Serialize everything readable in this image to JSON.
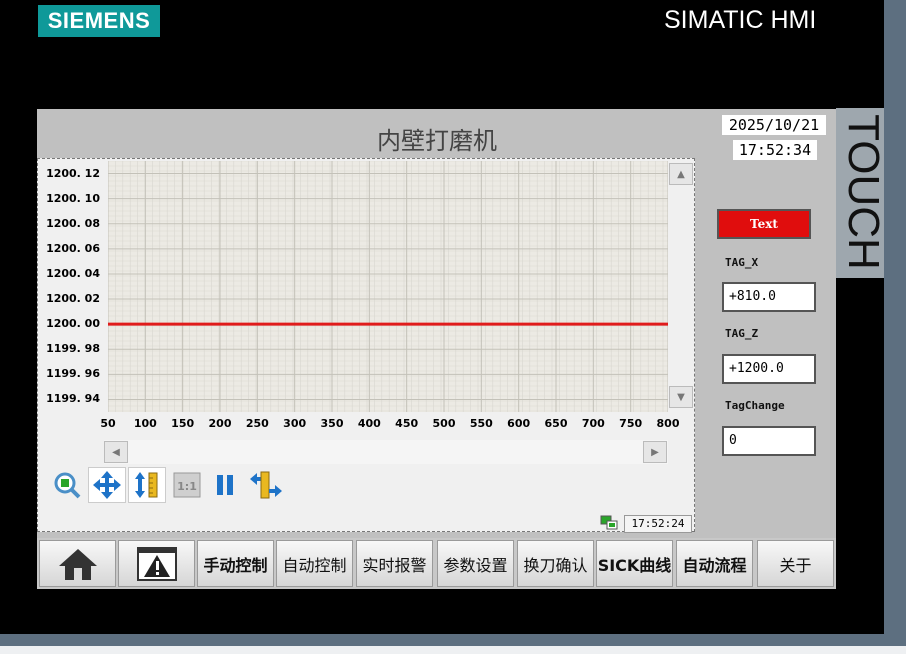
{
  "device": {
    "logo": "SIEMENS",
    "brand": "SIMATIC HMI",
    "side_label": "TOUCH"
  },
  "screen": {
    "title": "内壁打磨机",
    "date": "2025/10/21",
    "time": "17:52:34"
  },
  "trend": {
    "y_ticks": [
      "1200. 12",
      "1200. 10",
      "1200. 08",
      "1200. 06",
      "1200. 04",
      "1200. 02",
      "1200. 00",
      "1199. 98",
      "1199. 96",
      "1199. 94"
    ],
    "x_ticks": [
      "50",
      "100",
      "150",
      "200",
      "250",
      "300",
      "350",
      "400",
      "450",
      "500",
      "550",
      "600",
      "650",
      "700",
      "750",
      "800"
    ],
    "status_time": "17:52:24",
    "toolbar_icons": [
      "zoom-icon",
      "pan-icon",
      "ruler-icon",
      "reset-zoom-icon",
      "pause-icon",
      "ruler-select-icon"
    ]
  },
  "chart_data": {
    "type": "line",
    "xlim": [
      50,
      800
    ],
    "ylim": [
      1199.93,
      1200.13
    ],
    "series": [
      {
        "x": [
          50,
          800
        ],
        "y": [
          1200.0,
          1200.0
        ]
      }
    ],
    "grid": true,
    "colors": {
      "line": "#e01b1b"
    }
  },
  "panel": {
    "text_button": "Text",
    "tag_x_label": "TAG_X",
    "tag_x_value": "+810.0",
    "tag_z_label": "TAG_Z",
    "tag_z_value": "+1200.0",
    "tagchange_label": "TagChange",
    "tagchange_value": "0"
  },
  "nav": {
    "buttons": [
      {
        "icon": "home-icon"
      },
      {
        "icon": "alarm-icon"
      },
      {
        "label": "手动控制"
      },
      {
        "label": "自动控制"
      },
      {
        "label": "实时报警"
      },
      {
        "label": "参数设置"
      },
      {
        "label": "换刀确认"
      },
      {
        "label": "SICK曲线"
      },
      {
        "label": "自动流程"
      },
      {
        "label": "关于"
      }
    ]
  },
  "colors": {
    "logo": "#0f9999",
    "alarm_button": "#e00d0d",
    "trend_line": "#e01b1b"
  }
}
